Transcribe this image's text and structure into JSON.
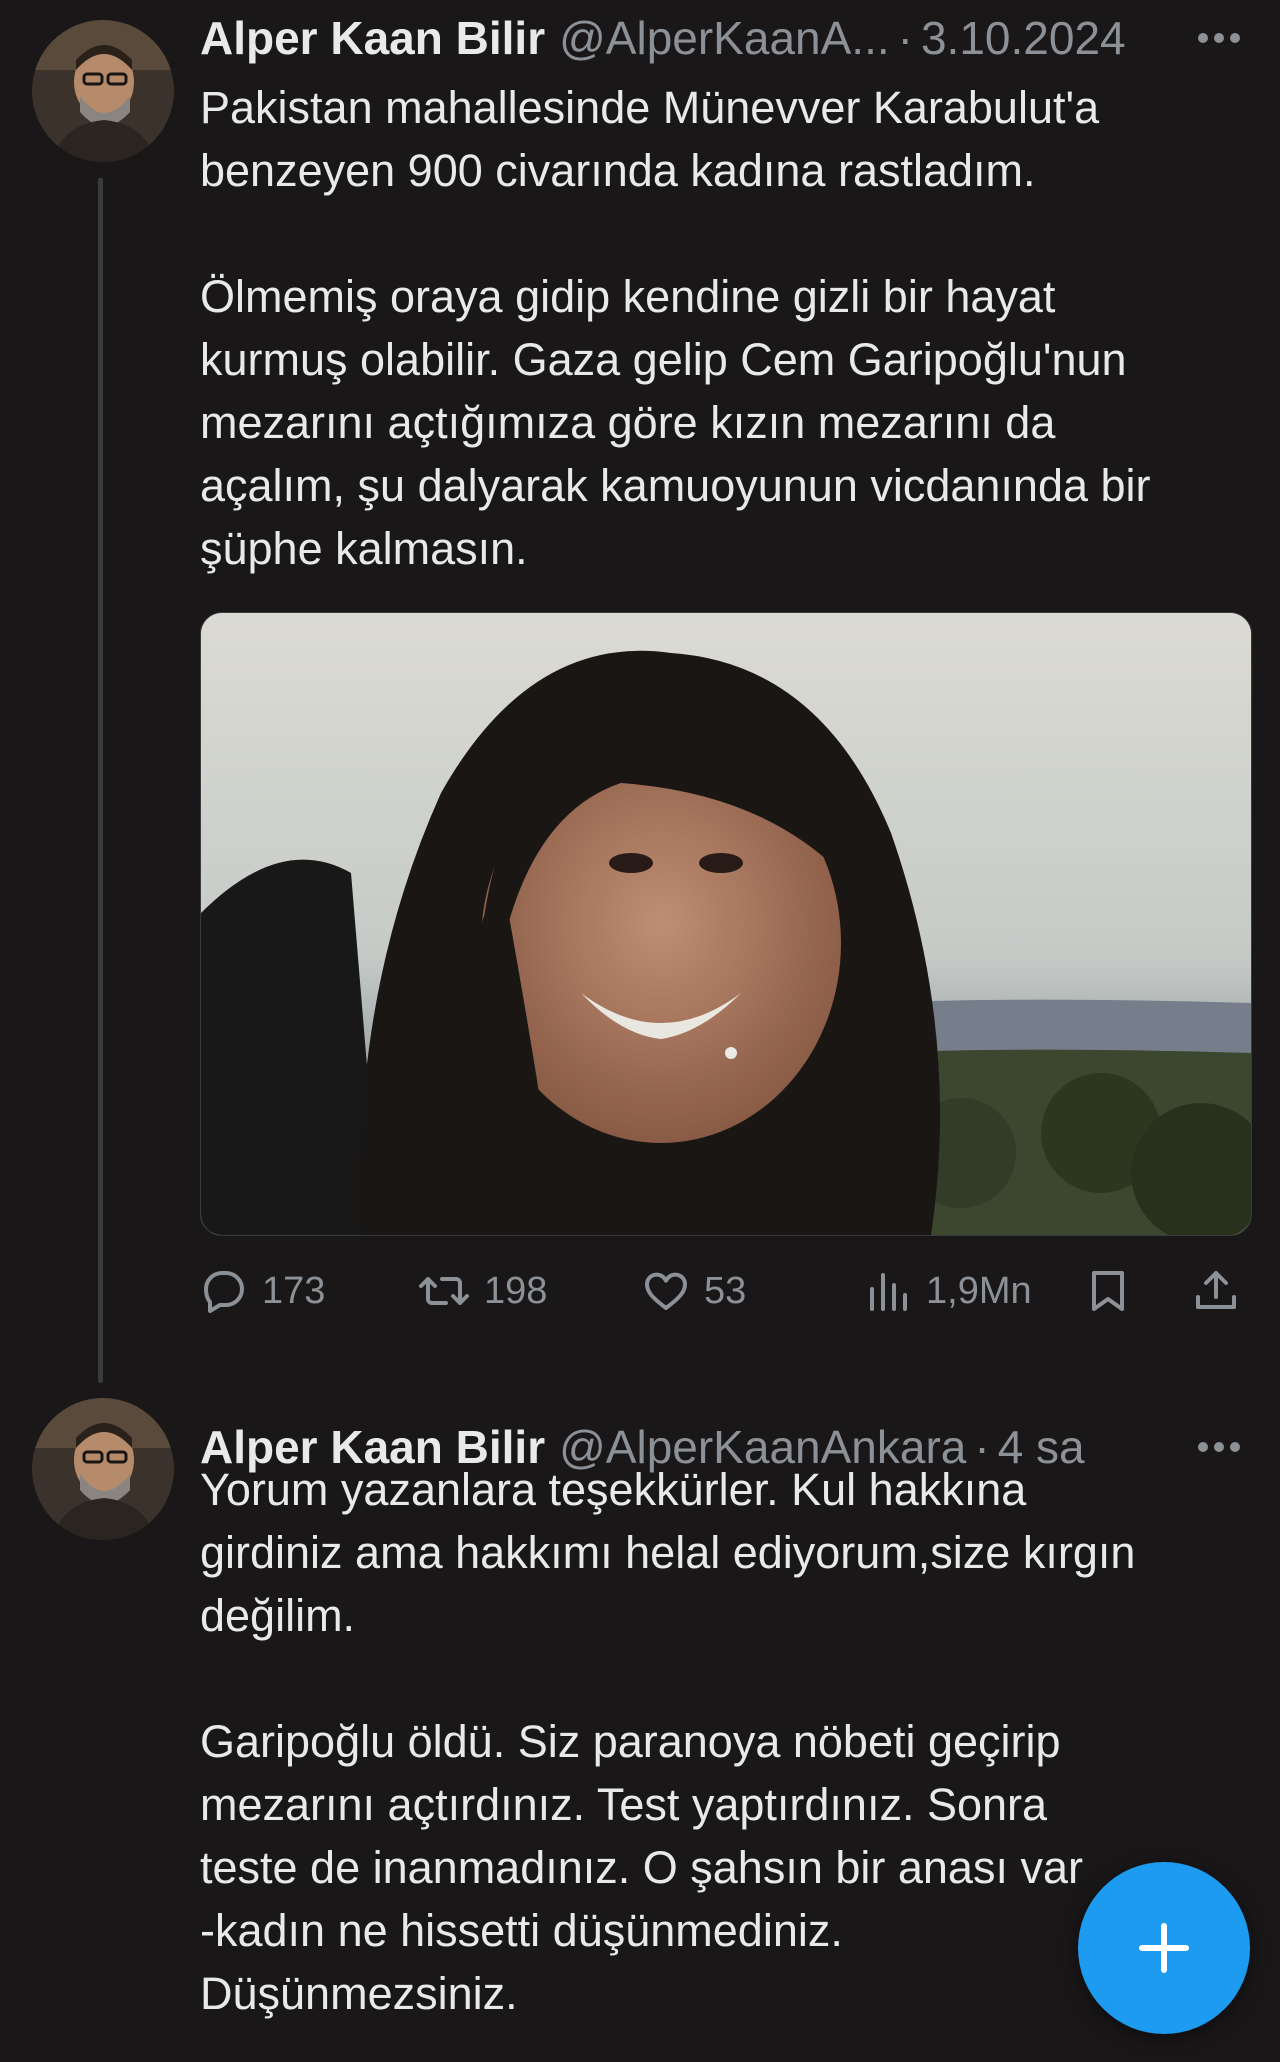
{
  "thread": [
    {
      "display_name": "Alper Kaan Bilir",
      "handle": "@AlperKaanA...",
      "separator": "·",
      "time": "3.10.2024",
      "text": "Pakistan mahallesinde Münevver Karabulut'a\nbenzeyen 900 civarında kadına rastladım.\n\nÖlmemiş oraya gidip kendine gizli bir hayat\nkurmuş olabilir. Gaza gelip Cem Garipoğlu'nun\nmezarını açtığımıza göre kızın mezarını da\naçalım, şu dalyarak kamuoyunun vicdanında bir\nşüphe kalmasın.",
      "has_photo": true,
      "actions": {
        "replies": "173",
        "reposts": "198",
        "likes": "53",
        "views": "1,9Mn"
      }
    },
    {
      "display_name": "Alper Kaan Bilir",
      "handle": "@AlperKaanAnkara",
      "separator": "·",
      "time": "4 sa",
      "text": "Yorum yazanlara teşekkürler. Kul hakkına\ngirdiniz ama hakkımı helal ediyorum,size kırgın\ndeğilim.\n\nGaripoğlu öldü. Siz paranoya nöbeti geçirip\nmezarını açtırdınız. Test yaptırdınız. Sonra\nteste de inanmadınız. O şahsın bir anası var\n-kadın ne hissetti düşünmediniz.\nDüşünmezsiniz."
    }
  ],
  "icons": {
    "more": "more-horizontal-icon",
    "reply": "reply-icon",
    "repost": "repost-icon",
    "like": "heart-icon",
    "views": "views-icon",
    "bookmark": "bookmark-icon",
    "share": "share-icon",
    "compose": "plus-icon"
  },
  "colors": {
    "background": "#1a1718",
    "text": "#e7e9ea",
    "secondary": "#8b9196",
    "accent": "#1d9bf0",
    "thread_line": "#3a3b3d"
  }
}
